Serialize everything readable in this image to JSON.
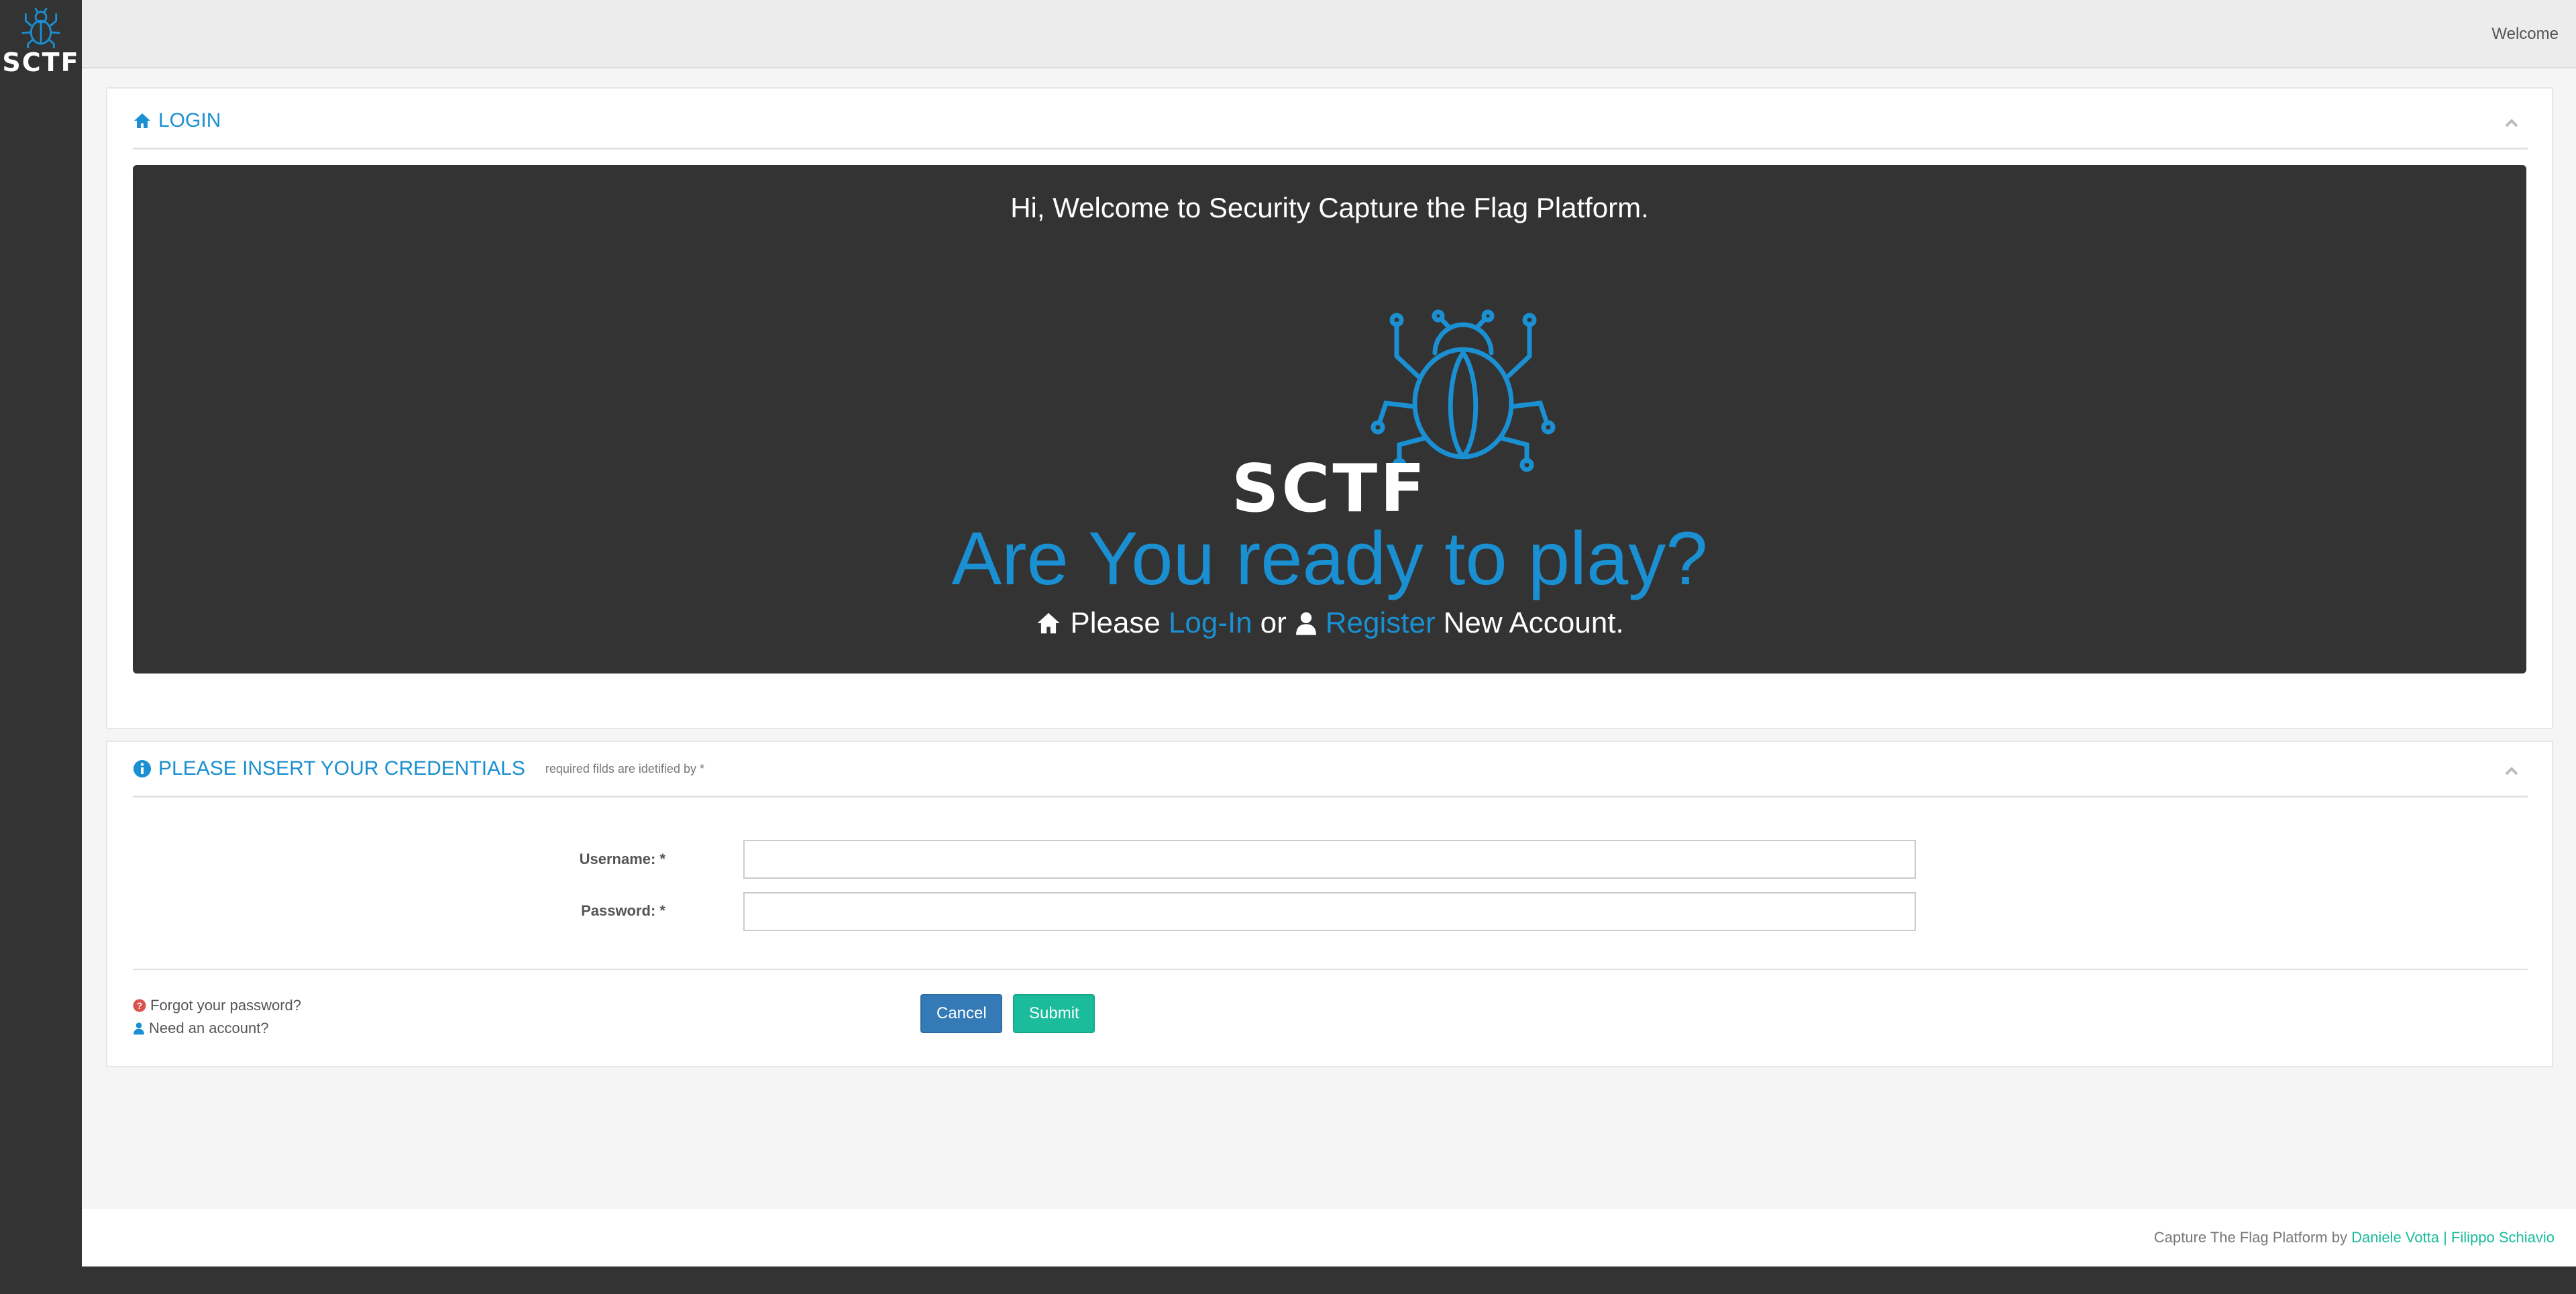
{
  "sidebar": {
    "logo_text": "SCTF"
  },
  "topbar": {
    "welcome": "Welcome"
  },
  "login_panel": {
    "title": "LOGIN",
    "hero": {
      "greeting": "Hi, Welcome to Security Capture the Flag Platform.",
      "logo_text": "SCTF",
      "headline": "Are You ready to play?",
      "please": "Please",
      "login_link": "Log-In",
      "or": "or",
      "register_link": "Register",
      "new_account": "New Account."
    }
  },
  "credentials_panel": {
    "title": "PLEASE INSERT YOUR CREDENTIALS",
    "subtitle": "required filds are idetified by *",
    "username_label": "Username: *",
    "password_label": "Password: *",
    "username_value": "",
    "password_value": "",
    "forgot_link": "Forgot your password?",
    "need_account_link": "Need an account?",
    "cancel_label": "Cancel",
    "submit_label": "Submit"
  },
  "footer": {
    "text": "Capture The Flag Platform by",
    "author1": "Daniele Votta",
    "separator": "|",
    "author2": "Filippo Schiavio"
  },
  "colors": {
    "accent": "#1a8fd1",
    "dark": "#333333",
    "green": "#1abc9c",
    "blue_button": "#337ab7"
  }
}
